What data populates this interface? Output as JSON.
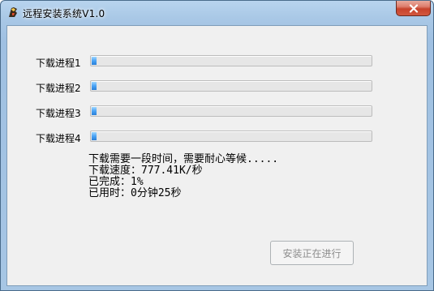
{
  "window": {
    "title": "远程安装系统V1.0",
    "app_icon": "app-logo-icon",
    "close_icon": "close-icon",
    "close_color": "#c7432c"
  },
  "progress_bars": [
    {
      "label": "下载进程1",
      "value": 0.01
    },
    {
      "label": "下载进程2",
      "value": 0.01
    },
    {
      "label": "下载进程3",
      "value": 0.01
    },
    {
      "label": "下载进程4",
      "value": 0.01
    }
  ],
  "status": {
    "message": "下载需要一段时间，需要耐心等候.....",
    "speed": "下载速度：777.41K/秒",
    "completed": "已完成：1%",
    "elapsed": "已用时：0分钟25秒"
  },
  "action_button": {
    "label": "安装正在进行",
    "enabled": false
  },
  "colors": {
    "progress_fill": "#2a7fd8",
    "client_bg": "#f0f0f0"
  }
}
